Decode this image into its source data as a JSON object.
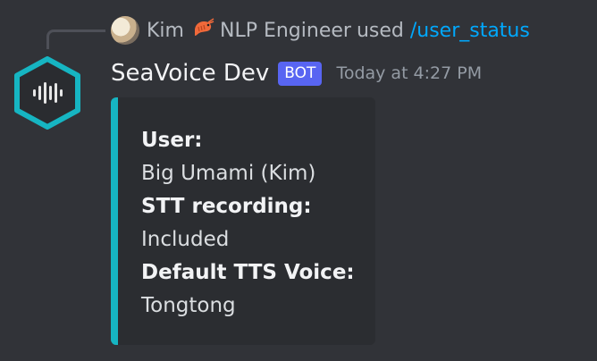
{
  "reply": {
    "name": "Kim",
    "badge_icon": "shrimp-icon",
    "role": "NLP Engineer",
    "used_text": "used",
    "command": "/user_status"
  },
  "message": {
    "author": "SeaVoice Dev",
    "bot_tag": "BOT",
    "timestamp": "Today at 4:27 PM"
  },
  "embed": {
    "accent_color": "#16b5c2",
    "fields": [
      {
        "name": "User:",
        "value": "Big Umami (Kim)"
      },
      {
        "name": "STT recording:",
        "value": "Included"
      },
      {
        "name": "Default TTS Voice:",
        "value": "Tongtong"
      }
    ]
  },
  "colors": {
    "background": "#313338",
    "embed_background": "#2b2d31",
    "link": "#00a8fc",
    "bot_tag": "#5865f2"
  }
}
